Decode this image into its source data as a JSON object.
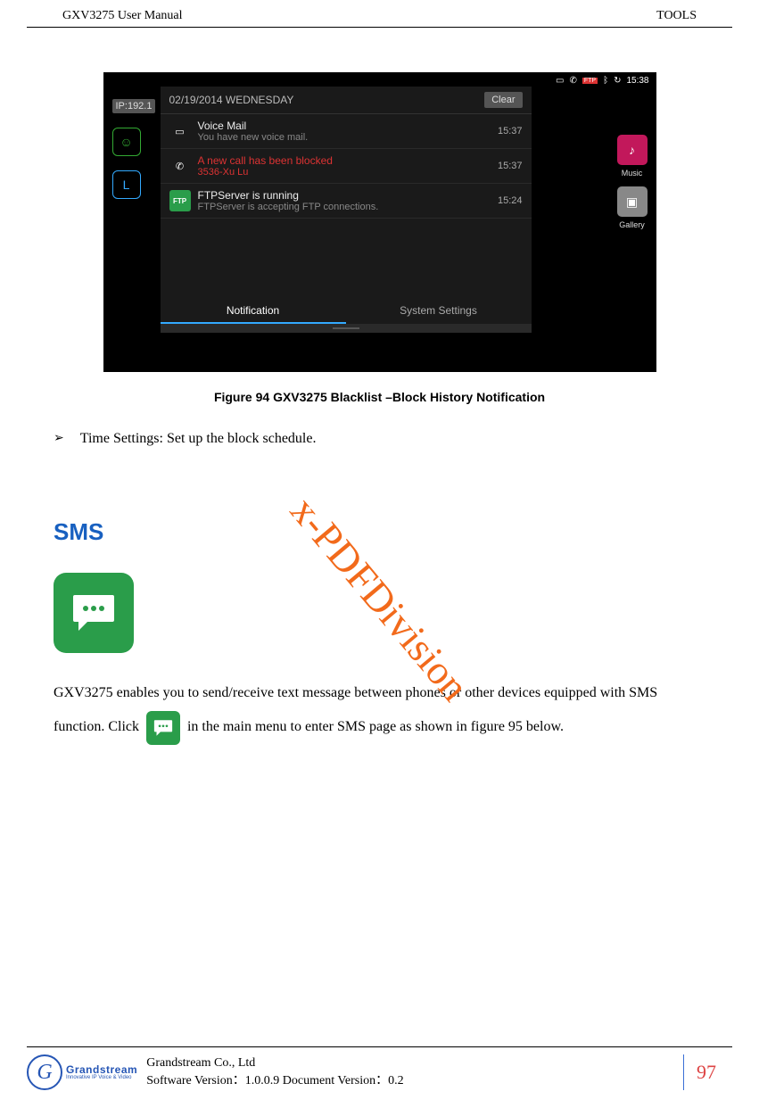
{
  "header": {
    "left": "GXV3275 User Manual",
    "right": "TOOLS"
  },
  "screenshot": {
    "status_time": "15:38",
    "ip_tag": "IP:192.1",
    "date": "02/19/2014 WEDNESDAY",
    "clear": "Clear",
    "notifications": [
      {
        "title": "Voice Mail",
        "sub": "You have new voice mail.",
        "time": "15:37",
        "red": false,
        "icon": "vm"
      },
      {
        "title": "A new call has been blocked",
        "sub": "3536-Xu Lu",
        "time": "15:37",
        "red": true,
        "icon": "call"
      },
      {
        "title": "FTPServer is running",
        "sub": "FTPServer is accepting FTP connections.",
        "time": "15:24",
        "red": false,
        "icon": "ftp"
      }
    ],
    "tabs": {
      "notification": "Notification",
      "system": "System Settings"
    },
    "apps": {
      "music": "Music",
      "gallery": "Gallery"
    },
    "ftp_label": "FTP"
  },
  "figure_caption": "Figure 94 GXV3275 Blacklist –Block History Notification",
  "bullet_text": "Time Settings: Set up the block schedule.",
  "section_heading": "SMS",
  "body": {
    "before_inline": "GXV3275 enables you to send/receive text message between phones or other devices equipped with SMS function. Click ",
    "after_inline": " in the main menu to enter SMS page as shown in figure 95 below."
  },
  "watermark": "x-PDFDivision",
  "footer": {
    "company": "Grandstream Co., Ltd",
    "version": "Software Version：1.0.0.9 Document Version：0.2",
    "logo_name": "Grandstream",
    "logo_tag": "Innovative IP Voice & Video",
    "page": "97"
  }
}
